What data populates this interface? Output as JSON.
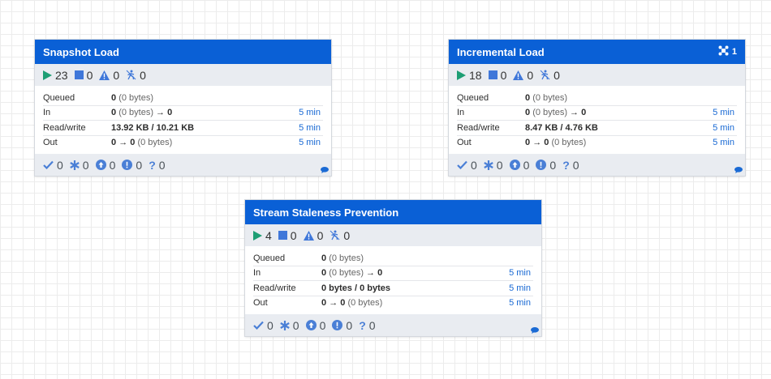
{
  "colors": {
    "header": "#0a60d6",
    "running": "#1d9e74",
    "stopped": "#3f77d9",
    "link": "#1a6ad4"
  },
  "labels": {
    "queued": "Queued",
    "in": "In",
    "readwrite": "Read/write",
    "out": "Out"
  },
  "groups": [
    {
      "title": "Snapshot Load",
      "badge": null,
      "running": "23",
      "stopped": "0",
      "invalid": "0",
      "disabled": "0",
      "queued": {
        "count": "0",
        "bytes": "(0 bytes)"
      },
      "in": {
        "count": "0",
        "bytes": "(0 bytes)",
        "arrow": "→",
        "out": "0",
        "time": "5 min"
      },
      "readwrite": {
        "value": "13.92 KB / 10.21 KB",
        "time": "5 min"
      },
      "out": {
        "count": "0",
        "arrow": "→",
        "to": "0",
        "bytes": "(0 bytes)",
        "time": "5 min"
      },
      "versions": {
        "up_to_date": "0",
        "locally_modified": "0",
        "stale": "0",
        "sync_failure": "0",
        "unknown": "0"
      }
    },
    {
      "title": "Incremental Load",
      "badge": {
        "icon": "connected-nodes-icon",
        "value": "1"
      },
      "running": "18",
      "stopped": "0",
      "invalid": "0",
      "disabled": "0",
      "queued": {
        "count": "0",
        "bytes": "(0 bytes)"
      },
      "in": {
        "count": "0",
        "bytes": "(0 bytes)",
        "arrow": "→",
        "out": "0",
        "time": "5 min"
      },
      "readwrite": {
        "value": "8.47 KB / 4.76 KB",
        "time": "5 min"
      },
      "out": {
        "count": "0",
        "arrow": "→",
        "to": "0",
        "bytes": "(0 bytes)",
        "time": "5 min"
      },
      "versions": {
        "up_to_date": "0",
        "locally_modified": "0",
        "stale": "0",
        "sync_failure": "0",
        "unknown": "0"
      }
    },
    {
      "title": "Stream Staleness Prevention",
      "badge": null,
      "running": "4",
      "stopped": "0",
      "invalid": "0",
      "disabled": "0",
      "queued": {
        "count": "0",
        "bytes": "(0 bytes)"
      },
      "in": {
        "count": "0",
        "bytes": "(0 bytes)",
        "arrow": "→",
        "out": "0",
        "time": "5 min"
      },
      "readwrite": {
        "value": "0 bytes / 0 bytes",
        "time": "5 min"
      },
      "out": {
        "count": "0",
        "arrow": "→",
        "to": "0",
        "bytes": "(0 bytes)",
        "time": "5 min"
      },
      "versions": {
        "up_to_date": "0",
        "locally_modified": "0",
        "stale": "0",
        "sync_failure": "0",
        "unknown": "0"
      }
    }
  ]
}
